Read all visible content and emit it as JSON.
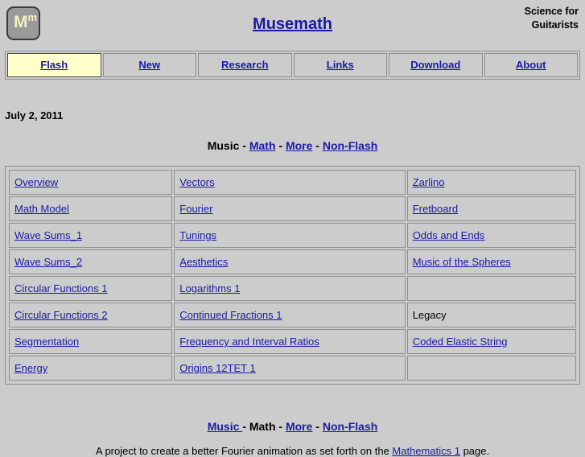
{
  "header": {
    "logo": {
      "main": "M",
      "sup": "m",
      "name": "musemath-logo"
    },
    "site_title": "Musemath",
    "tagline_line1": "Science for",
    "tagline_line2": "Guitarists"
  },
  "nav": {
    "tabs": [
      {
        "label": "Flash ",
        "active": true
      },
      {
        "label": "New",
        "active": false
      },
      {
        "label": "Research",
        "active": false
      },
      {
        "label": "Links",
        "active": false
      },
      {
        "label": "Download",
        "active": false
      },
      {
        "label": "About",
        "active": false
      }
    ]
  },
  "content": {
    "date": "July 2, 2011",
    "top_nav": {
      "items": [
        {
          "label": "Music",
          "is_link": false
        },
        {
          "label": "Math",
          "is_link": true
        },
        {
          "label": "More",
          "is_link": true
        },
        {
          "label": "Non-Flash",
          "is_link": true
        }
      ],
      "separator": "-"
    },
    "bottom_nav": {
      "items": [
        {
          "label": "Music ",
          "is_link": true
        },
        {
          "label": "Math",
          "is_link": false
        },
        {
          "label": "More",
          "is_link": true
        },
        {
          "label": "Non-Flash",
          "is_link": true
        }
      ],
      "separator": "-"
    },
    "grid": {
      "rows": [
        [
          {
            "label": "Overview",
            "is_link": true
          },
          {
            "label": "Vectors",
            "is_link": true
          },
          {
            "label": "Zarlino",
            "is_link": true
          }
        ],
        [
          {
            "label": "Math Model",
            "is_link": true
          },
          {
            "label": "Fourier",
            "is_link": true
          },
          {
            "label": "Fretboard",
            "is_link": true
          }
        ],
        [
          {
            "label": "Wave Sums_1",
            "is_link": true
          },
          {
            "label": "Tunings",
            "is_link": true
          },
          {
            "label": "Odds and Ends",
            "is_link": true
          }
        ],
        [
          {
            "label": "Wave Sums_2",
            "is_link": true
          },
          {
            "label": "Aesthetics",
            "is_link": true
          },
          {
            "label": "Music of the Spheres",
            "is_link": true
          }
        ],
        [
          {
            "label": "Circular Functions 1",
            "is_link": true
          },
          {
            "label": "Logarithms 1",
            "is_link": true
          },
          {
            "label": "",
            "is_link": false
          }
        ],
        [
          {
            "label": "Circular Functions 2",
            "is_link": true
          },
          {
            "label": "Continued Fractions 1",
            "is_link": true
          },
          {
            "label": "Legacy",
            "is_link": false
          }
        ],
        [
          {
            "label": "Segmentation",
            "is_link": true
          },
          {
            "label": "Frequency and Interval Ratios",
            "is_link": true
          },
          {
            "label": "Coded Elastic String",
            "is_link": true
          }
        ],
        [
          {
            "label": "Energy",
            "is_link": true
          },
          {
            "label": "Origins 12TET 1",
            "is_link": true
          },
          {
            "label": "",
            "is_link": false
          }
        ]
      ]
    },
    "footer": {
      "before": "A project to create a better Fourier animation as set forth on the ",
      "link": "Mathematics 1",
      "after": " page."
    }
  },
  "colors": {
    "page_background": "#cccccc",
    "link": "#1a1aa8",
    "active_tab_background": "#ffffcc",
    "border": "#8e8e8e",
    "logo_background": "#9a9a9a",
    "logo_text": "#f2f0c0"
  }
}
